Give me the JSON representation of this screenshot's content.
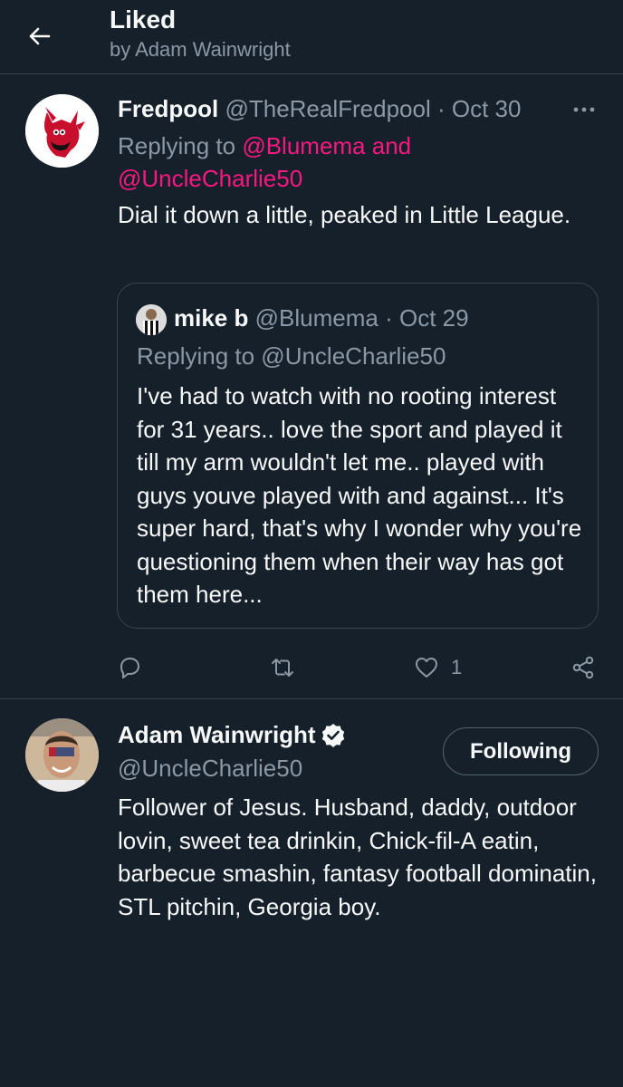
{
  "header": {
    "title": "Liked",
    "subtitle": "by Adam Wainwright"
  },
  "tweet": {
    "author_name": "Fredpool",
    "author_handle": "@TheRealFredpool",
    "separator": "·",
    "date": "Oct 30",
    "replying_prefix": "Replying to ",
    "replying_to_1": "@Blumema",
    "replying_joiner": " and ",
    "replying_to_2": "@UncleCharlie50",
    "text": "Dial it down a little, peaked in Little League.",
    "quote": {
      "author_name": "mike b",
      "author_handle": "@Blumema",
      "separator": "·",
      "date": "Oct 29",
      "replying": "Replying to @UncleCharlie50",
      "text": "I've had to watch with no rooting interest for 31 years.. love the sport and played it till my arm wouldn't let me.. played with guys youve played with and against... It's super hard, that's why I wonder why you're questioning them when their way has got them here..."
    },
    "actions": {
      "reply_icon": "reply-icon",
      "retweet_icon": "retweet-icon",
      "like_icon": "heart-icon",
      "like_count": "1",
      "share_icon": "share-icon"
    }
  },
  "profile": {
    "name": "Adam Wainwright",
    "verified": true,
    "handle": "@UncleCharlie50",
    "follow_label": "Following",
    "bio": "Follower of Jesus. Husband, daddy, outdoor lovin, sweet tea drinkin, Chick-fil-A eatin, barbecue smashin, fantasy football dominatin, STL pitchin, Georgia boy."
  },
  "colors": {
    "background": "#15202b",
    "divider": "#38444d",
    "muted_text": "#8b98a5",
    "mention_link": "#f91880",
    "primary_text": "#f7f9f9"
  }
}
